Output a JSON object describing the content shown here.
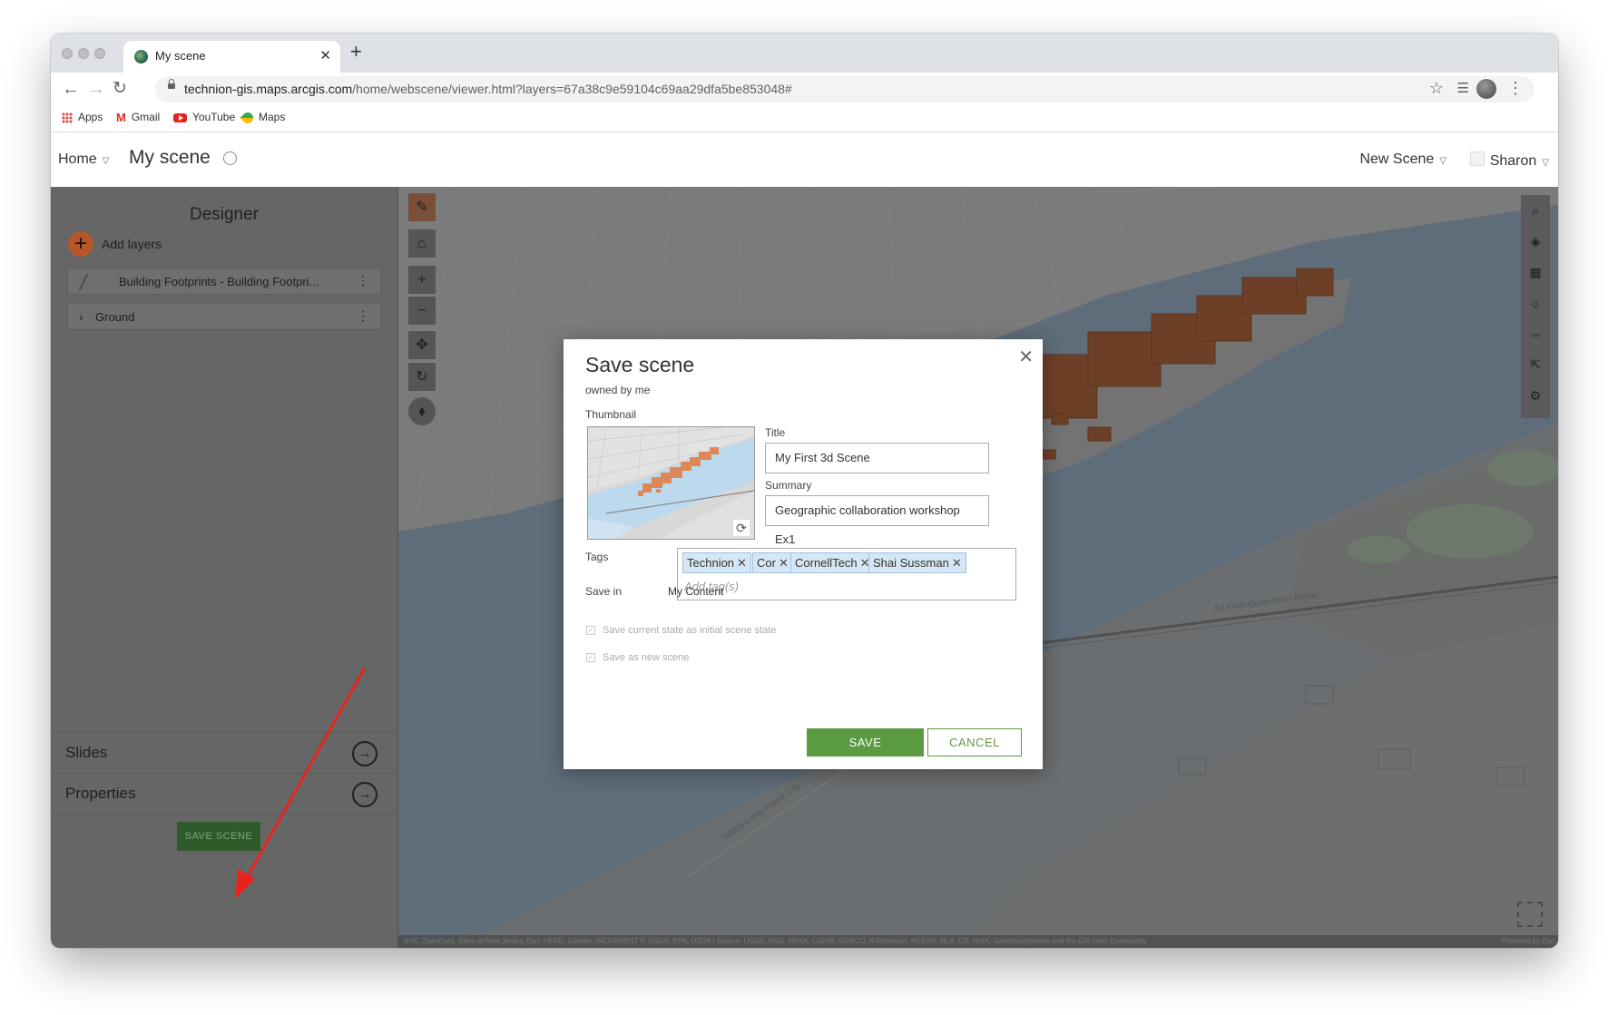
{
  "browser": {
    "tab_title": "My scene",
    "url_host": "technion-gis.maps.arcgis.com",
    "url_path": "/home/webscene/viewer.html?layers=67a38c9e59104c69aa29dfa5be853048#",
    "bookmarks": [
      {
        "label": "Apps",
        "icon": "apps-grid-icon"
      },
      {
        "label": "Gmail",
        "icon": "gmail-icon"
      },
      {
        "label": "YouTube",
        "icon": "youtube-icon"
      },
      {
        "label": "Maps",
        "icon": "maps-icon"
      }
    ]
  },
  "header": {
    "home": "Home",
    "title": "My scene",
    "new_scene": "New Scene",
    "user": "Sharon"
  },
  "designer": {
    "title": "Designer",
    "add_layers": "Add layers",
    "layers": [
      {
        "label": "Building Footprints - Building Footpri..."
      },
      {
        "label": "Ground"
      }
    ],
    "slides": "Slides",
    "properties": "Properties",
    "save_scene": "SAVE SCENE"
  },
  "dialog": {
    "title": "Save scene",
    "owned_by": "owned by me",
    "thumbnail_label": "Thumbnail",
    "title_label": "Title",
    "title_value": "My First 3d Scene",
    "summary_label": "Summary",
    "summary_value": "Geographic collaboration workshop Ex1",
    "tags_label": "Tags",
    "tags": [
      "Technion",
      "Cor",
      "CornellTech",
      "Shai Sussman"
    ],
    "tags_placeholder": "Add tag(s)",
    "save_in_label": "Save in",
    "save_in_value": "My Content",
    "checkbox_initial_state": "Save current state as initial scene state",
    "checkbox_new_scene": "Save as new scene",
    "save_button": "SAVE",
    "cancel_button": "CANCEL"
  },
  "scene": {
    "attribution": "NYC OpenData, State of New Jersey, Esri, HERE, Garmin, INCREMENT P, USGS, EPA, USDA | Source: USGS, NGA, NASA, CGIAR, GEBCO, N Robinson, NCEAS, NLS, OS, NMA, Geodatastyrelsen and the GIS User Community",
    "powered_by": "Powered by Esri",
    "street_label": "Ed Koch Queensboro Bridge",
    "road_label": "Island-Long Island City"
  },
  "colors": {
    "accent_green": "#5a9a41",
    "building_orange": "#b4552c",
    "save_scene_green": "#2f5b2a",
    "annotation_red": "#e8231e"
  }
}
